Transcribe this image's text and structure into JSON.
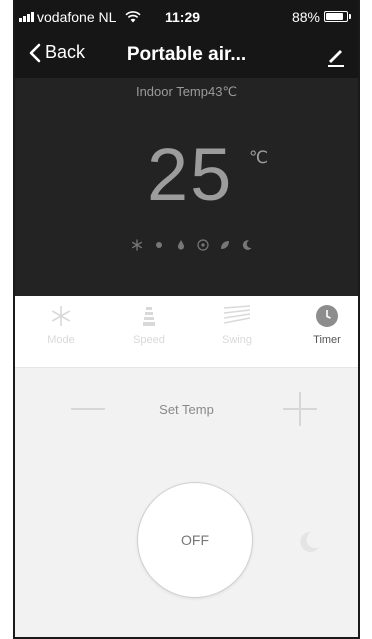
{
  "status_bar": {
    "carrier": "vodafone NL",
    "time": "11:29",
    "battery_percent": "88%",
    "battery_level": 0.88,
    "icons": [
      "signal-icon",
      "wifi-icon",
      "battery-icon"
    ]
  },
  "nav": {
    "back_label": "Back",
    "title": "Portable air...",
    "icons": [
      "chevron-left-icon",
      "edit-pencil-icon"
    ]
  },
  "display": {
    "indoor_temp": "Indoor Temp43℃",
    "set_temp_value": "25",
    "unit": "℃",
    "mode_icons": [
      "snowflake-icon",
      "sun-icon",
      "droplet-icon",
      "fan-icon",
      "leaf-icon",
      "moon-icon"
    ]
  },
  "tabs": [
    {
      "label": "Mode",
      "icon": "snowflake-icon",
      "active": false
    },
    {
      "label": "Speed",
      "icon": "fan-speed-icon",
      "active": false
    },
    {
      "label": "Swing",
      "icon": "swing-icon",
      "active": false
    },
    {
      "label": "Timer",
      "icon": "clock-icon",
      "active": true
    }
  ],
  "controls": {
    "set_temp_label": "Set Temp",
    "power_label": "OFF",
    "icons": [
      "minus-icon",
      "plus-icon",
      "moon-icon"
    ]
  },
  "colors": {
    "header_bg": "#161616",
    "display_bg": "#232323",
    "controls_bg": "#f2f2f2",
    "text_muted": "#9c9c9c"
  }
}
